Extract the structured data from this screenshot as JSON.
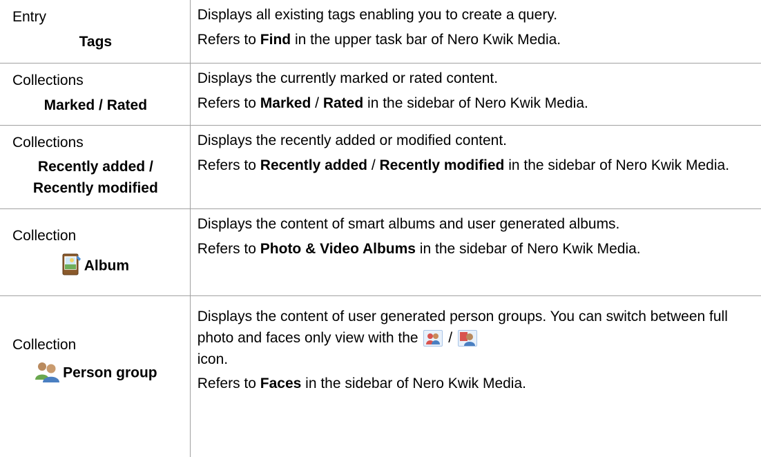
{
  "rows": [
    {
      "category": "Entry",
      "name": "Tags",
      "line1": "Displays all existing tags enabling you to create a query.",
      "line2_pre": "Refers to ",
      "line2_b1": "Find",
      "line2_post": " in the upper task bar of Nero Kwik Media."
    },
    {
      "category": "Collections",
      "name": "Marked / Rated",
      "line1": "Displays the currently marked or rated content.",
      "line2_pre": "Refers to ",
      "line2_b1": "Marked",
      "line2_mid": " / ",
      "line2_b2": "Rated",
      "line2_post": " in the sidebar of Nero Kwik Media."
    },
    {
      "category": "Collections",
      "name_line1": "Recently added /",
      "name_line2": "Recently modified",
      "line1": "Displays the recently added or modified content.",
      "line2_pre": "Refers to ",
      "line2_b1": "Recently added",
      "line2_mid": " / ",
      "line2_b2": "Recently modified",
      "line2_post": " in the sidebar of Nero Kwik Media."
    },
    {
      "category": "Collection",
      "name": "Album",
      "icon": "album-icon",
      "line1": "Displays the content of smart albums and user generated albums.",
      "line2_pre": "Refers to ",
      "line2_b1": "Photo & Video Albums",
      "line2_post": " in the sidebar of Nero Kwik Media."
    },
    {
      "category": "Collection",
      "name": "Person group",
      "icon": "person-group-icon",
      "line1_pre": "Displays the content of user generated person groups. You can switch between full photo and faces only view with the",
      "line1_sep": "/",
      "line1_post": "icon.",
      "icon_full_photo": "full-photo-view-icon",
      "icon_faces": "faces-only-view-icon",
      "line2_pre": "Refers to ",
      "line2_b1": "Faces",
      "line2_post": " in the sidebar of Nero Kwik Media."
    }
  ]
}
